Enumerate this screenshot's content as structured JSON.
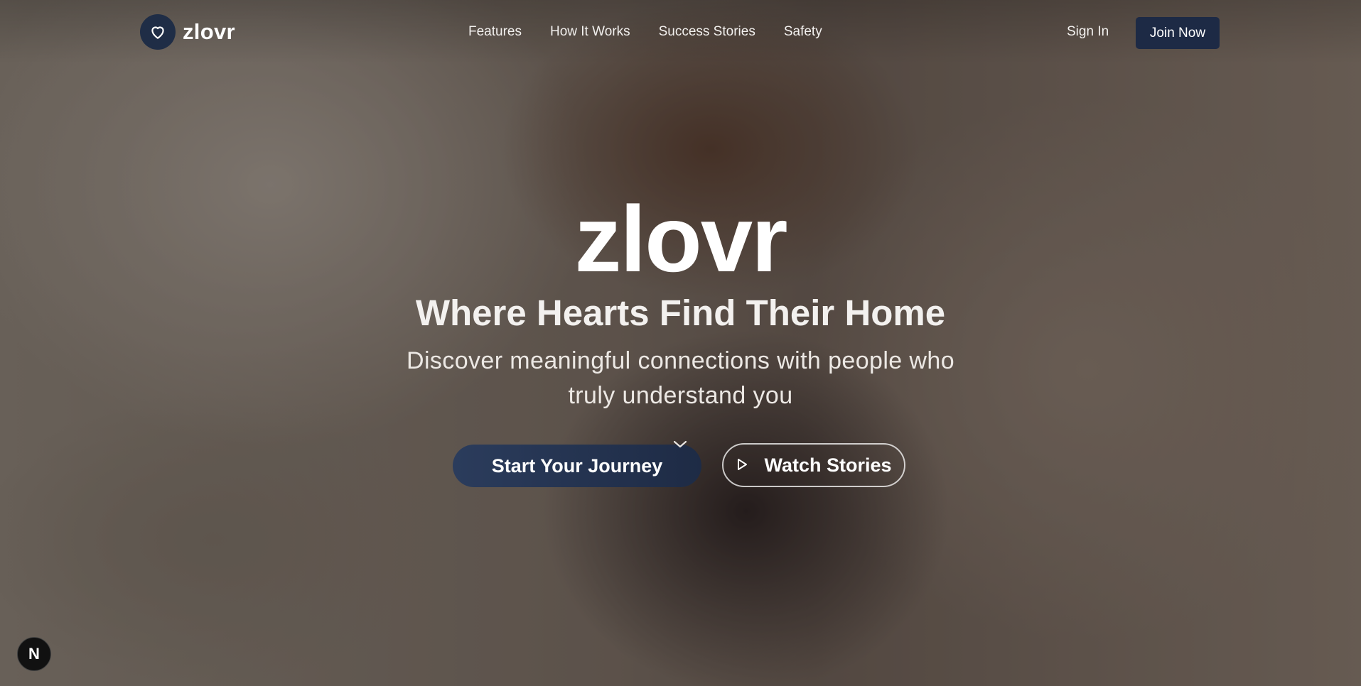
{
  "brand": {
    "name": "zlovr",
    "logo_icon": "heart-icon",
    "accent_color": "#1f2d46"
  },
  "nav": {
    "links": [
      "Features",
      "How It Works",
      "Success Stories",
      "Safety"
    ],
    "sign_in": "Sign In",
    "join": "Join Now"
  },
  "hero": {
    "title": "zlovr",
    "tagline": "Where Hearts Find Their Home",
    "subtext": "Discover meaningful connections with people who truly understand you",
    "primary_cta": "Start Your Journey",
    "secondary_cta": "Watch Stories",
    "secondary_icon": "play-icon",
    "scroll_icon": "chevron-down-icon"
  },
  "corner_badge": {
    "label": "N",
    "icon": "next-logo-icon"
  }
}
